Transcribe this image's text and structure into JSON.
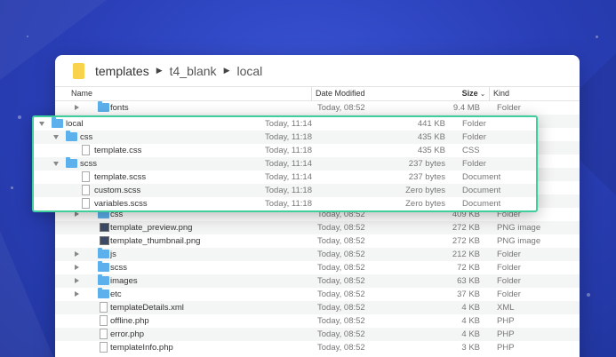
{
  "breadcrumb": [
    "templates",
    "t4_blank",
    "local"
  ],
  "columns": {
    "name": "Name",
    "date": "Date Modified",
    "size": "Size",
    "kind": "Kind"
  },
  "background_rows": [
    {
      "name": "fonts",
      "type": "folder",
      "date": "Today, 08:52",
      "size": "9.4 MB",
      "kind": "Folder"
    },
    {
      "name": "",
      "type": "none",
      "date": "",
      "size": "",
      "kind": ""
    },
    {
      "name": "",
      "type": "none",
      "date": "",
      "size": "",
      "kind": ""
    },
    {
      "name": "",
      "type": "none",
      "date": "",
      "size": "",
      "kind": ""
    },
    {
      "name": "",
      "type": "none",
      "date": "",
      "size": "",
      "kind": ""
    },
    {
      "name": "",
      "type": "none",
      "date": "",
      "size": "",
      "kind": ""
    },
    {
      "name": "",
      "type": "none",
      "date": "",
      "size": "",
      "kind": ""
    },
    {
      "name": "",
      "type": "none",
      "date": "",
      "size": "",
      "kind": ""
    },
    {
      "name": "css",
      "type": "folder",
      "date": "Today, 08:52",
      "size": "409 KB",
      "kind": "Folder"
    },
    {
      "name": "template_preview.png",
      "type": "image",
      "date": "Today, 08:52",
      "size": "272 KB",
      "kind": "PNG image"
    },
    {
      "name": "template_thumbnail.png",
      "type": "image",
      "date": "Today, 08:52",
      "size": "272 KB",
      "kind": "PNG image"
    },
    {
      "name": "js",
      "type": "folder",
      "date": "Today, 08:52",
      "size": "212 KB",
      "kind": "Folder"
    },
    {
      "name": "scss",
      "type": "folder",
      "date": "Today, 08:52",
      "size": "72 KB",
      "kind": "Folder"
    },
    {
      "name": "images",
      "type": "folder",
      "date": "Today, 08:52",
      "size": "63 KB",
      "kind": "Folder"
    },
    {
      "name": "etc",
      "type": "folder",
      "date": "Today, 08:52",
      "size": "37 KB",
      "kind": "Folder"
    },
    {
      "name": "templateDetails.xml",
      "type": "doc",
      "date": "Today, 08:52",
      "size": "4 KB",
      "kind": "XML"
    },
    {
      "name": "offline.php",
      "type": "doc",
      "date": "Today, 08:52",
      "size": "4 KB",
      "kind": "PHP"
    },
    {
      "name": "error.php",
      "type": "doc",
      "date": "Today, 08:52",
      "size": "4 KB",
      "kind": "PHP"
    },
    {
      "name": "templateInfo.php",
      "type": "doc",
      "date": "Today, 08:52",
      "size": "3 KB",
      "kind": "PHP"
    }
  ],
  "overlay_rows": [
    {
      "name": "local",
      "type": "folder",
      "level": 0,
      "expanded": true,
      "date": "Today, 11:14",
      "size": "441 KB",
      "kind": "Folder"
    },
    {
      "name": "css",
      "type": "folder",
      "level": 1,
      "expanded": true,
      "date": "Today, 11:18",
      "size": "435 KB",
      "kind": "Folder"
    },
    {
      "name": "template.css",
      "type": "doc",
      "level": 2,
      "expanded": false,
      "date": "Today, 11:18",
      "size": "435 KB",
      "kind": "CSS"
    },
    {
      "name": "scss",
      "type": "folder",
      "level": 1,
      "expanded": true,
      "date": "Today, 11:14",
      "size": "237 bytes",
      "kind": "Folder"
    },
    {
      "name": "template.scss",
      "type": "doc",
      "level": 2,
      "expanded": false,
      "date": "Today, 11:14",
      "size": "237 bytes",
      "kind": "Document"
    },
    {
      "name": "custom.scss",
      "type": "doc",
      "level": 2,
      "expanded": false,
      "date": "Today, 11:18",
      "size": "Zero bytes",
      "kind": "Document"
    },
    {
      "name": "variables.scss",
      "type": "doc",
      "level": 2,
      "expanded": false,
      "date": "Today, 11:18",
      "size": "Zero bytes",
      "kind": "Document"
    }
  ]
}
